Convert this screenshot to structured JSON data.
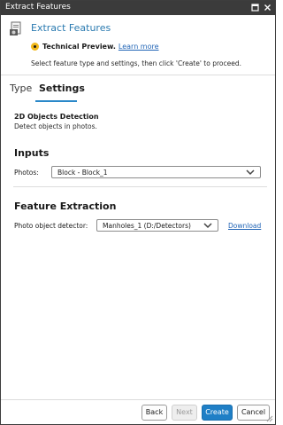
{
  "window": {
    "title": "Extract Features"
  },
  "header": {
    "title": "Extract Features",
    "preview_label": "Technical Preview.",
    "learn_more": "Learn more",
    "instruction": "Select feature type and settings, then click 'Create' to proceed."
  },
  "tabs": [
    {
      "label": "Type",
      "selected": false
    },
    {
      "label": "Settings",
      "selected": true
    }
  ],
  "feature": {
    "name": "2D Objects Detection",
    "description": "Detect objects in photos."
  },
  "inputs": {
    "heading": "Inputs",
    "photos_label": "Photos:",
    "photos_value": "Block - Block_1"
  },
  "feature_extraction": {
    "heading": "Feature Extraction",
    "detector_label": "Photo object detector:",
    "detector_value": "Manholes_1 (D:/Detectors)",
    "download_link": "Download"
  },
  "footer": {
    "back": "Back",
    "next": "Next",
    "create": "Create",
    "cancel": "Cancel"
  },
  "icons": {
    "window_restore": "restore-icon",
    "window_close": "close-icon",
    "header": "extract-features-icon",
    "preview": "preview-badge-icon",
    "dropdown": "chevron-down-icon"
  },
  "colors": {
    "titlebar": "#3b3b3b",
    "accent": "#1f7fc6",
    "header_title": "#2a7ab0",
    "link": "#1f63b5",
    "tab_indicator": "#2a88c9",
    "preview_badge": "#f2b91a"
  }
}
